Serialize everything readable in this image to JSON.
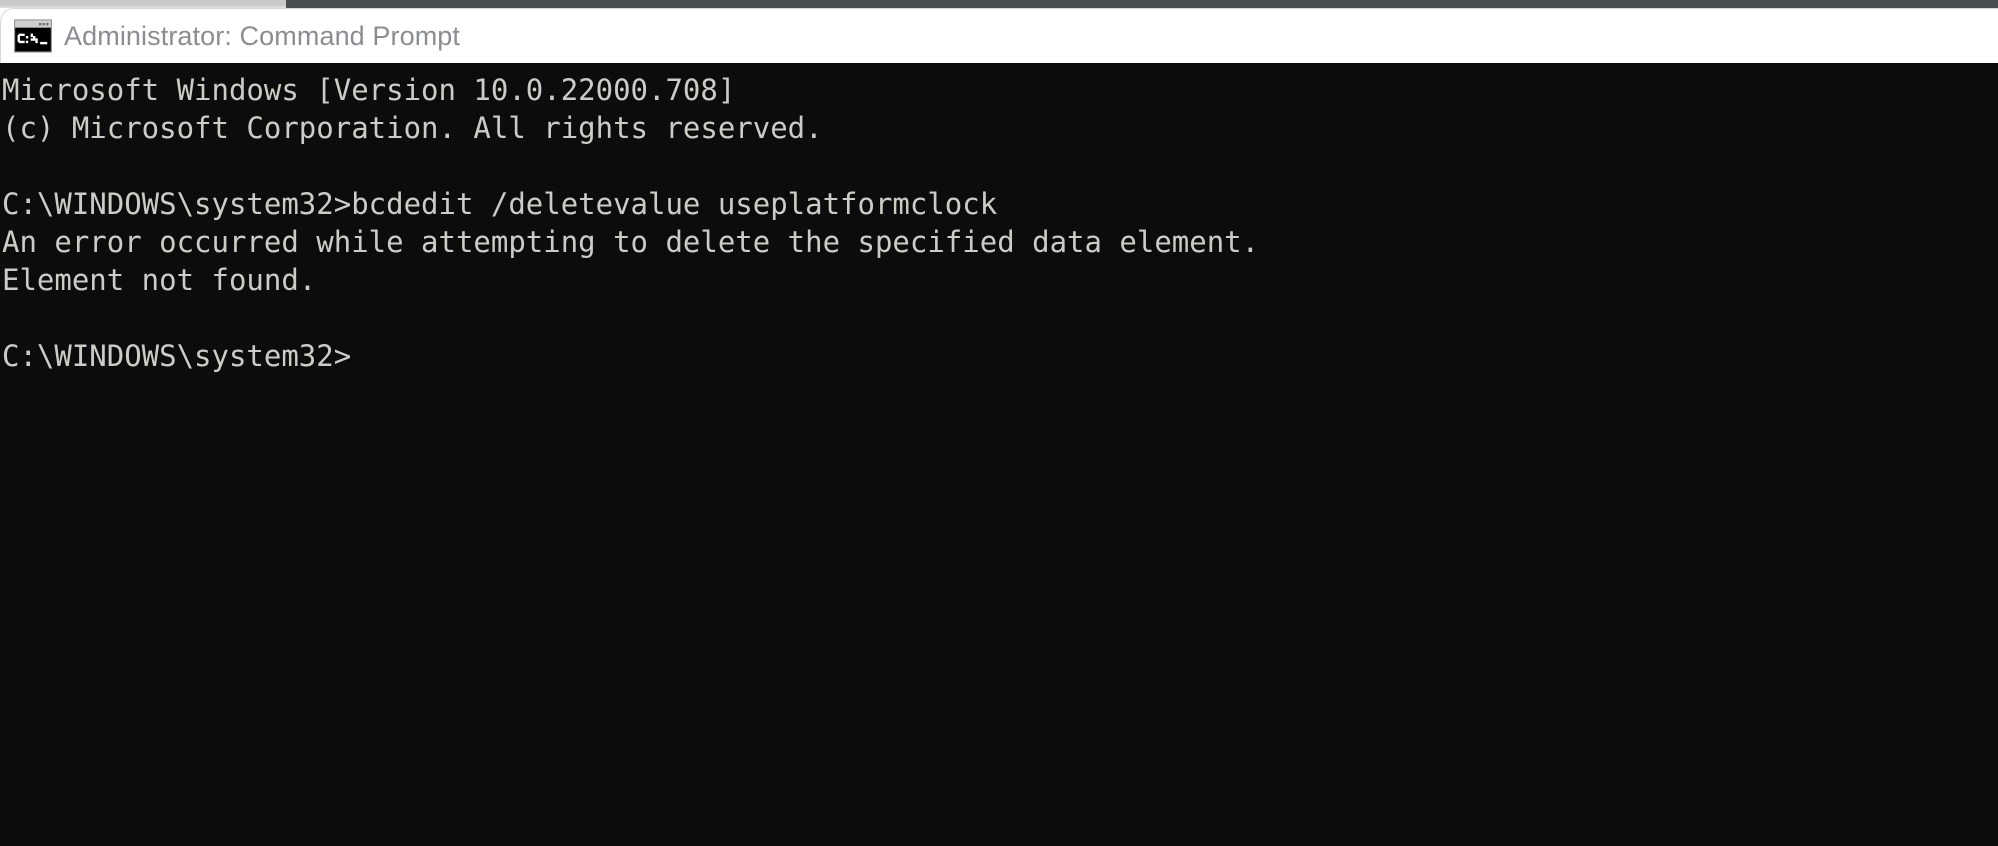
{
  "window": {
    "title": "Administrator: Command Prompt",
    "icon": "command-prompt-icon",
    "background_color": "#0c0c0c",
    "titlebar_color": "#ffffff",
    "title_text_color": "#8a8d91",
    "terminal_text_color": "#ccccc7"
  },
  "terminal": {
    "lines": [
      "Microsoft Windows [Version 10.0.22000.708]",
      "(c) Microsoft Corporation. All rights reserved.",
      "",
      "C:\\WINDOWS\\system32>bcdedit /deletevalue useplatformclock",
      "An error occurred while attempting to delete the specified data element.",
      "Element not found.",
      "",
      "C:\\WINDOWS\\system32>"
    ],
    "os_name": "Microsoft Windows",
    "os_version": "10.0.22000.708",
    "copyright": "(c) Microsoft Corporation. All rights reserved.",
    "prompt": "C:\\WINDOWS\\system32>",
    "command": "bcdedit /deletevalue useplatformclock",
    "error_message": "An error occurred while attempting to delete the specified data element.",
    "error_detail": "Element not found."
  }
}
